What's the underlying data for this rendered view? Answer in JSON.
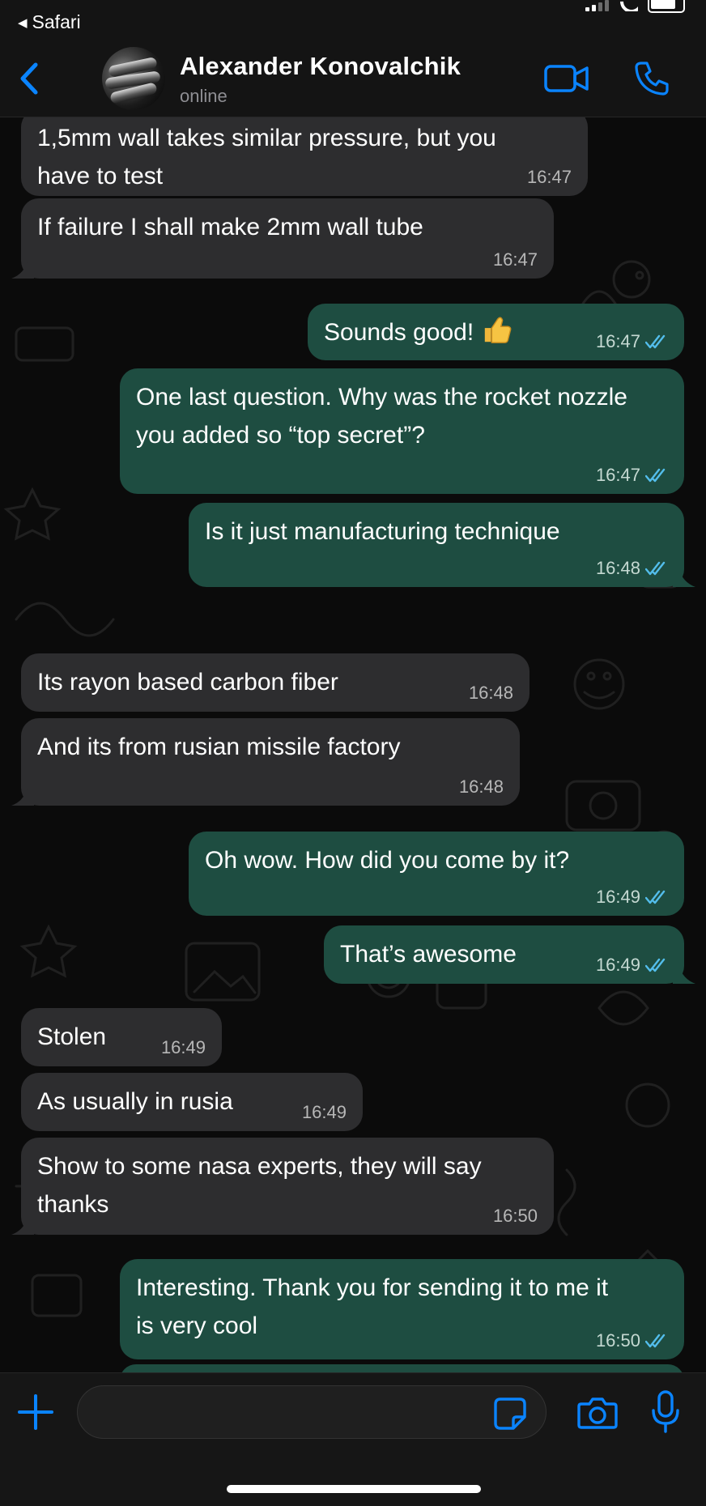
{
  "status_bar": {
    "back_app": "Safari"
  },
  "header": {
    "contact_name": "Alexander Konovalchik",
    "contact_status": "online",
    "accent_color": "#0a84ff",
    "icons": [
      "chevron-left-icon",
      "video-call-icon",
      "phone-icon"
    ]
  },
  "messages": [
    {
      "dir": "in",
      "text": "1,5mm wall takes similar pressure, but you have to test",
      "time": "16:47"
    },
    {
      "dir": "in",
      "text": "If failure I shall make 2mm wall tube",
      "time": "16:47"
    },
    {
      "dir": "out",
      "text": "Sounds good!",
      "emoji": "thumbs-up",
      "time": "16:47",
      "read": true
    },
    {
      "dir": "out",
      "text": "One last question. Why was the rocket nozzle you added so “top secret”?",
      "time": "16:47",
      "read": true
    },
    {
      "dir": "out",
      "text": "Is it just manufacturing technique",
      "time": "16:48",
      "read": true
    },
    {
      "dir": "in",
      "text": "Its rayon based carbon fiber",
      "time": "16:48"
    },
    {
      "dir": "in",
      "text": "And its from rusian missile factory",
      "time": "16:48"
    },
    {
      "dir": "out",
      "text": "Oh wow. How did you come by it?",
      "time": "16:49",
      "read": true
    },
    {
      "dir": "out",
      "text": "That’s awesome",
      "time": "16:49",
      "read": true
    },
    {
      "dir": "in",
      "text": "Stolen",
      "time": "16:49"
    },
    {
      "dir": "in",
      "text": "As usually in rusia",
      "time": "16:49"
    },
    {
      "dir": "in",
      "text": "Show to some nasa experts, they will say thanks",
      "time": "16:50"
    },
    {
      "dir": "out",
      "text": "Interesting. Thank you for sending it to me it is very cool",
      "time": "16:50",
      "read": true
    }
  ],
  "input_bar": {
    "placeholder": "",
    "icons": [
      "plus-icon",
      "sticker-icon",
      "camera-icon",
      "microphone-icon"
    ]
  },
  "colors": {
    "incoming_bubble": "#2d2d2f",
    "outgoing_bubble": "#1e4d41",
    "background": "#0b0b0b",
    "read_ticks": "#53bdeb"
  }
}
